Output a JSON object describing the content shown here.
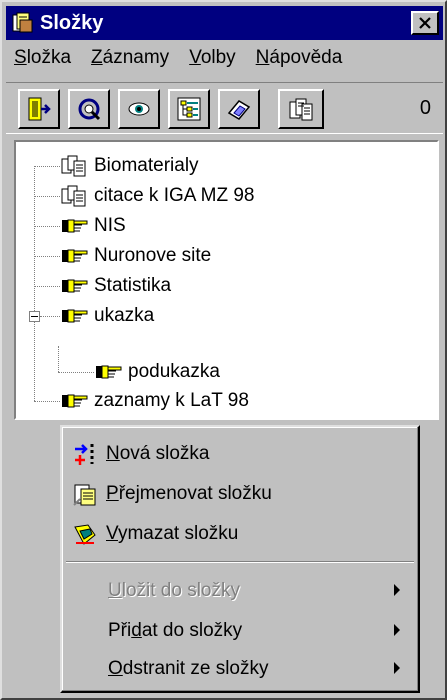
{
  "window": {
    "title": "Složky"
  },
  "menubar": [
    {
      "label": "Složka",
      "accel": "S"
    },
    {
      "label": "Záznamy",
      "accel": "Z"
    },
    {
      "label": "Volby",
      "accel": "V"
    },
    {
      "label": "Nápověda",
      "accel": "N"
    }
  ],
  "toolbar": {
    "buttons": [
      "exit-door-icon",
      "refresh-search-icon",
      "eye-view-icon",
      "tree-list-icon",
      "eraser-icon",
      "folders-icon"
    ],
    "count": "0"
  },
  "tree": {
    "items": [
      {
        "label": "Biomaterialy",
        "icon": "document-stack-icon"
      },
      {
        "label": "citace k IGA MZ 98",
        "icon": "document-stack-icon"
      },
      {
        "label": "NIS",
        "icon": "pointing-hand-icon"
      },
      {
        "label": "Nuronove site",
        "icon": "pointing-hand-icon"
      },
      {
        "label": "Statistika",
        "icon": "pointing-hand-icon"
      },
      {
        "label": "ukazka",
        "icon": "pointing-hand-icon",
        "expanded": true
      },
      {
        "label": "podukazka",
        "icon": "pointing-hand-icon"
      },
      {
        "label": "zaznamy k LaT 98",
        "icon": "pointing-hand-icon"
      }
    ]
  },
  "context_menu": {
    "items": [
      {
        "pre": "",
        "accel": "N",
        "post": "ová složka",
        "icon": "new-folder-icon"
      },
      {
        "pre": "",
        "accel": "P",
        "post": "řejmenovat složku",
        "icon": "rename-icon"
      },
      {
        "pre": "",
        "accel": "V",
        "post": "ymazat složku",
        "icon": "delete-icon"
      },
      {
        "pre": "",
        "accel": "U",
        "post": "ložit do složky",
        "disabled": true
      },
      {
        "pre": "Při",
        "accel": "d",
        "post": "at do složky"
      },
      {
        "pre": "",
        "accel": "O",
        "post": "dstranit ze složky"
      }
    ]
  },
  "colors": {
    "titlebar": "#000080",
    "face": "#c0c0c0",
    "window": "#ffffff"
  }
}
